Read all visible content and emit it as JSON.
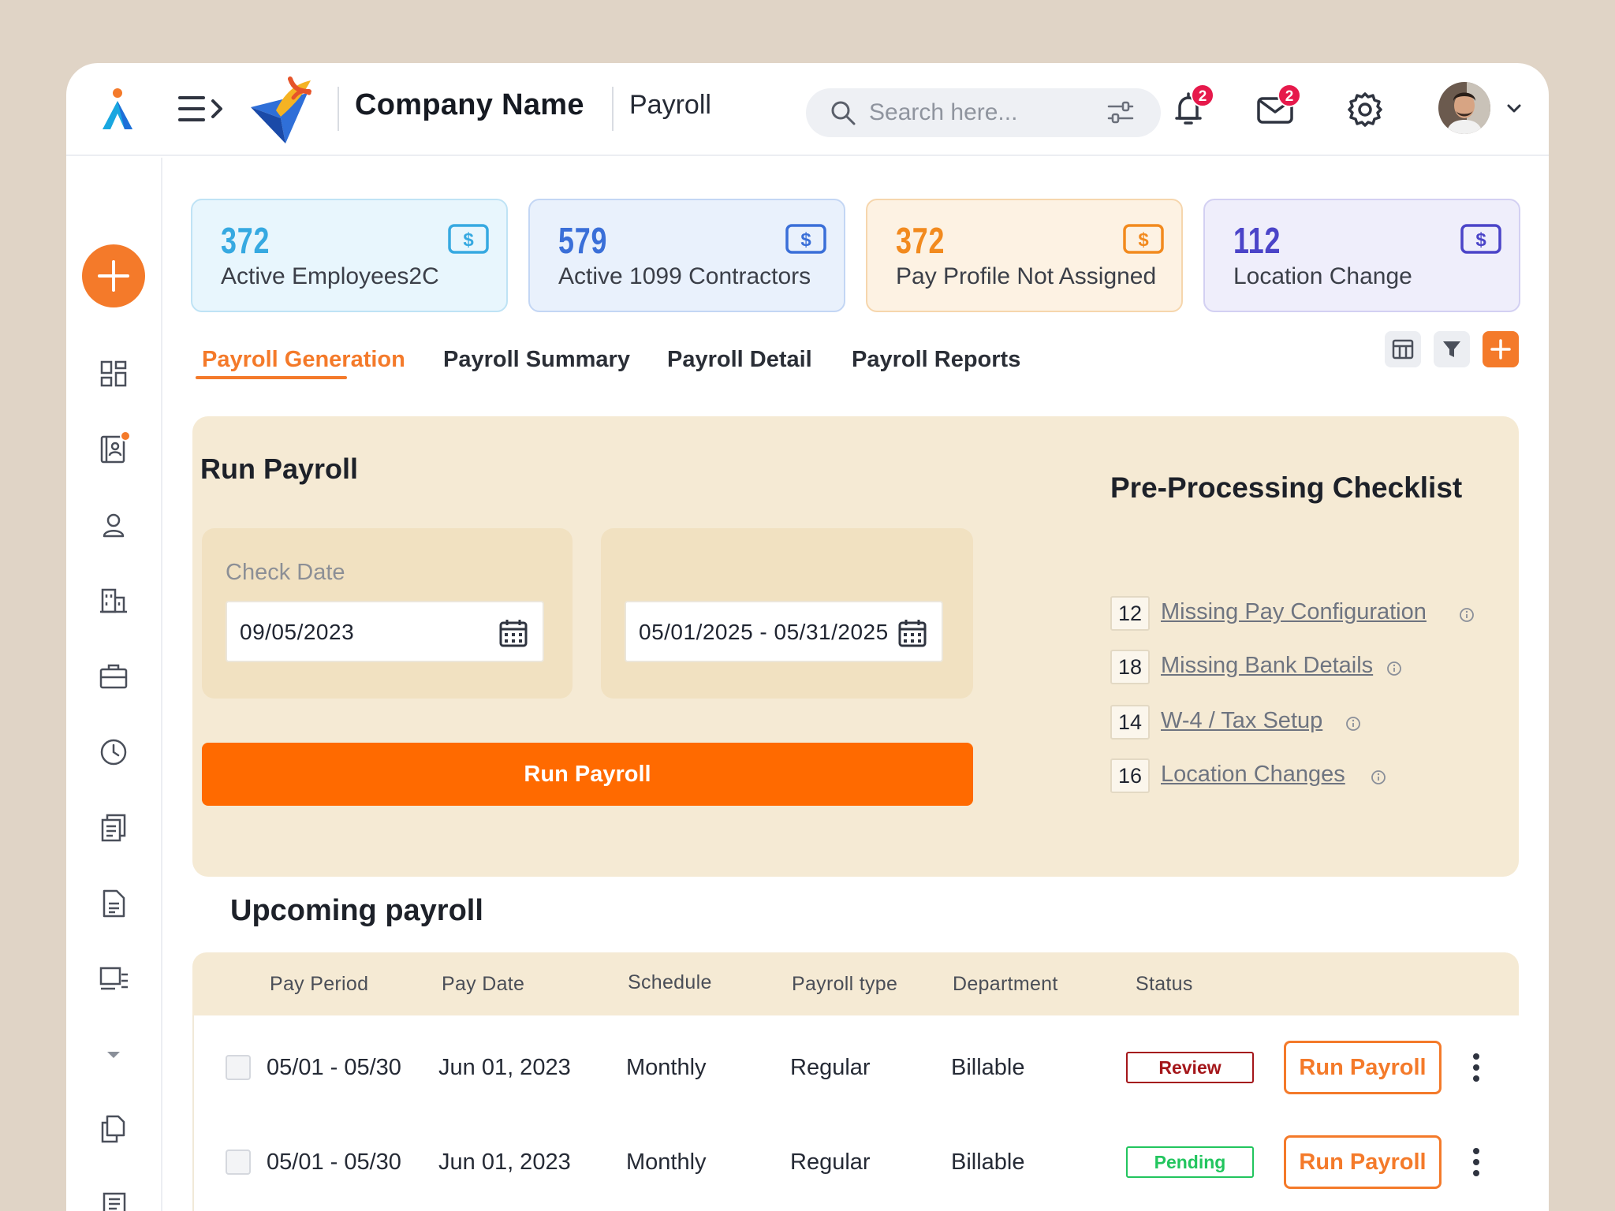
{
  "app": {
    "company_name": "Company Name",
    "module": "Payroll"
  },
  "search": {
    "placeholder": "Search here..."
  },
  "notifications": {
    "bell_count": "2",
    "mail_count": "2"
  },
  "stats": [
    {
      "value": "372",
      "label": "Active Employees2C",
      "color": "#36a9e1"
    },
    {
      "value": "579",
      "label": "Active 1099 Contractors",
      "color": "#3a6fd8"
    },
    {
      "value": "372",
      "label": "Pay Profile Not Assigned",
      "color": "#f28a1e"
    },
    {
      "value": "112",
      "label": "Location Change",
      "color": "#4b44c8"
    }
  ],
  "tabs": [
    {
      "label": "Payroll Generation",
      "active": true
    },
    {
      "label": "Payroll Summary",
      "active": false
    },
    {
      "label": "Payroll Detail",
      "active": false
    },
    {
      "label": "Payroll Reports",
      "active": false
    }
  ],
  "run_panel": {
    "title": "Run Payroll",
    "check_date_label": "Check Date",
    "check_date_value": "09/05/2023",
    "range_value": "05/01/2025 - 05/31/2025",
    "run_button": "Run Payroll"
  },
  "checklist": {
    "title": "Pre-Processing Checklist",
    "items": [
      {
        "count": "12",
        "label": "Missing Pay Configuration"
      },
      {
        "count": "18",
        "label": "Missing Bank Details"
      },
      {
        "count": "14",
        "label": "W-4 / Tax Setup"
      },
      {
        "count": "16",
        "label": "Location Changes"
      }
    ]
  },
  "upcoming": {
    "title": "Upcoming payroll",
    "columns": [
      "Pay Period",
      "Pay Date",
      "Schedule",
      "Payroll type",
      "Department",
      "Status"
    ],
    "rows": [
      {
        "period": "05/01 - 05/30",
        "date": "Jun 01, 2023",
        "schedule": "Monthly",
        "type": "Regular",
        "department": "Billable",
        "status": "Review",
        "action": "Run Payroll"
      },
      {
        "period": "05/01 - 05/30",
        "date": "Jun 01, 2023",
        "schedule": "Monthly",
        "type": "Regular",
        "department": "Billable",
        "status": "Pending",
        "action": "Run Payroll"
      }
    ]
  },
  "colors": {
    "accent": "#f47a2a",
    "primary_button": "#ff6a00",
    "panel": "#f5ead4",
    "review": "#a4161a",
    "pending": "#22c55e"
  }
}
